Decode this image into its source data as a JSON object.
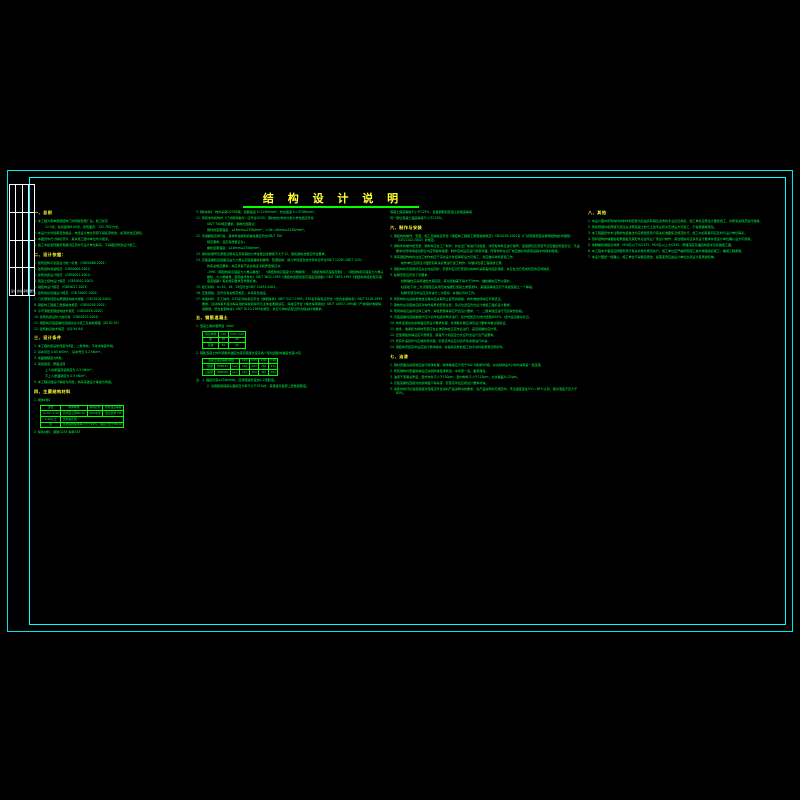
{
  "drawing": {
    "title": "结 构 设 计 说 明",
    "colors": {
      "background": "#000000",
      "border": "#00ffff",
      "heading": "#ffff33",
      "body": "#00ff44",
      "titleblock": "#ffffff"
    }
  },
  "title_block": {
    "rows": [
      [
        "",
        "",
        "",
        ""
      ],
      [
        "",
        "",
        "",
        ""
      ],
      [
        "",
        "",
        "",
        ""
      ],
      [
        "设计",
        "校对",
        "审核",
        "图号"
      ]
    ]
  },
  "col1": {
    "sections": [
      {
        "heading": "一、总则",
        "items": [
          "1. 本工程为某单层钢结构门式刚架轻钢厂房；檐口标高",
          "12.5米，柱间距离6.00米，建筑面积：152.78平方米。",
          "2. 本设计文件经审查合格后，未经设计单位同意不得任意修改，如有修改应通知。",
          "3. 本图纸中尺寸除标高外，其余施工图中单位均为毫米。",
          "4. 施工中如发现图纸有疑问应及时与设计单位联系，不得擅自修改设计施工。"
        ]
      },
      {
        "heading": "二、设计依据：",
        "items": [
          "1. 建筑结构可靠度设计统一标准            （GB50068-2001）",
          "2. 建筑结构荷载规范                      （GB50009-2001）",
          "3. 建筑抗震设计规范                      （GB50011-2001）",
          "4. 混凝土结构设计规范                    （GB50010-2002）",
          "5. 钢结构设计规范                        （GB50017-2003）",
          "6. 建筑地基基础设计规范                  （GB 50007-2002）",
          "7. 门式刚架轻型房屋钢结构技术规程        （CECS102:2002）",
          "8. 钢结构工程施工质量验收规范            （GB50205-2001）",
          "9. 冷弯薄壁型钢结构技术规范              （GB50018-2002）",
          "10. 建筑抗震设防分类标准                  （GB50223-2004）",
          "11. 钢结构高强度螺栓连接的设计施工及验收规程（JGJ 82-91）",
          "12. 建筑桩基技术规范                      （JGJ 94-94）"
        ]
      },
      {
        "heading": "三、设计条件",
        "items": [
          "1. 本工程抗震设防烈度为6度，二类场地，不考虑地震作用。",
          "2. 基本风压 0.65 kN/m²。    基本雪压 0.2 kN/m²。",
          "3. 地面粗糙度为B类。",
          "4. 荷载取值：屋面活荷",
          "  上人的屋面荷载取值为 0.5 kN/m²；",
          "  不上人屋面取值为 0.5 kN/m²。",
          "5. 本工程基础设计等级为丙级，地基基础设计等级为丙级。"
        ]
      },
      {
        "heading": "四、主要结构材料",
        "items": [
          "1. 砌体材料"
        ],
        "table": {
          "headers": [
            "部位",
            "砌体种类",
            "砌筑砂浆",
            "砂浆强度等级"
          ],
          "rows": [
            [
              "-0.20～1.20",
              "页岩实心砖MU10",
              "M10水泥",
              "混合砂浆 M5"
            ],
            [
              "1.20以上",
              "页岩多孔砖",
              "",
              ""
            ],
            [
              "注",
              "页岩砖的吸水率不大于25%，强度不低于MU10"
            ]
          ]
        },
        "items_after": [
          "2. 焊条材料：钢筋Q235 焊条E43"
        ]
      }
    ]
  },
  "col2": {
    "items": [
      "3. 钢材材料：构件采用Q235B钢，屈服强度 f=215N/mm²，抗拉强度 fᵤ=370N/mm²。",
      "11. 所有零件和构件（门式刚架板件）应符合Q345，钢材的化学成分和力学性能应符合",
      "GB/T 700规定要求，钢材的屈服点：",
      "  钢材的屈服强度：≤16mm≥235N/mm²，>16～40mm≥225N/mm²。",
      "12. 普通螺栓应用C级，其材料性能和机械性能应符合GB/T 700",
      "  规定要求，且应有质量证书；",
      "  螺栓屈服强度：≤16mm≥235N/mm²。",
      "13. 钢材的钢号及质量证明书应具有钢的力学性能且含碳量不大于12，硫和磷的含量应符合要求。",
      "14. 高强度螺栓连接副应由大六角头高强度螺栓和螺母、垫圈组成，其力学性能及技术条件应符合GB/T 1228～GB/T 1231",
      "  的有关规定要求，并应具有产品合格证书和质量保证书；",
      "  -1991《钢结构用高强度大六角头螺栓》、《钢结构用高强度大六角螺母》、《钢结构用高强度垫圈》、《钢结构用高强度大六角头螺栓、大六角螺母、垫圈技术条件》GB/T 3632-1995《钢结构用扭剪型高强度连接副》GB/T 3633-1995《钢结构用扭剪型高强度连接副》有关规定要求及质量标准。",
      "15. 栓钉材料：d=10、16、19应符合GB/T 10433-2002。",
      "16. 压型钢板：应符合有关规范规定，并具有合格证。",
      "17. 焊接材料：手工焊时，E43系列焊条应符合《碳钢焊条》GB/T 5117-1995；E50系列焊条应符合《低合金钢焊条》GB/T 5118-1995要求。自动焊和半自动焊采用的焊丝和焊剂与主体金属相适应，焊丝应符合《熔化焊用钢丝》GB/T 14957-1994和《气体保护电弧焊用碳钢、低合金钢焊丝》GB/T 8110-1995的规定，并应与母材匹配且符合相关标准要求。"
    ],
    "sections": [
      {
        "heading": "五、钢筋混凝土",
        "items": [
          "1. 混凝土保护层厚度（mm）"
        ],
        "table1": {
          "headers": [
            "环境\\构件",
            "C20",
            "C25～C45"
          ],
          "rows": [
            [
              "梁",
              "30",
              "25"
            ],
            [
              "基础",
              "40",
              "40"
            ]
          ]
        },
        "items_mid": [
          "2. 钢筋混凝土构件钢筋的锚固长度和搭接长度及各个受拉钢筋的锚固长度La见"
        ],
        "table2": {
          "headers": [
            "混凝土强度等级\\钢筋",
            "C20",
            "C25",
            "C30",
            "C40"
          ],
          "rows": [
            [
              "一级钢",
              "HPB235",
              "La=",
              "30d",
              "28d",
              "25d",
              "23d"
            ],
            [
              "二级钢",
              "HRB335",
              "La=",
              "44d",
              "35d",
              "31d",
              "29d"
            ]
          ]
        },
        "items_after": [
          "注：1. 锚固长度≥250mm时，应按搭接长度的1.2倍取值。",
          "  2. 当钢筋搭接接头面积百分率不大于25%时，其搭接长度按上表数值取值。"
        ]
      }
    ]
  },
  "col3": {
    "intro": [
      "混凝土强度等级不小于C25%，且各钢筋和混凝土的强度等级",
      "同一部位混凝土强度等级不小于C25%。"
    ],
    "sections": [
      {
        "heading": "六、制作与安装",
        "items": [
          "1. 钢结构的制作、安装、施工及验收应符合《钢结构工程施工质量验收规范》GB50205-2001及《门式刚架轻型房屋钢结构技术规程》（CECS102:2002）的规定。",
          "2. 钢构件的制作和安装：钢构件应在工厂制作，并在出厂前进行试组装，对所有构件应进行编号，连接部位及安装节点应做出明显标记，凡是要求在现场焊接的部位均应预留焊接量，制作完成后应进行防腐处理。所有构件在出厂前应做好防腐和运输中的保护措施。",
          "3. 所有钢结构构件在加工制作前应于深化设计并经审核后方可施工，并应做好材料复验工作；",
          "  制作单位应按设计图纸和有关标准进行加工制作，并做好隐蔽工程验收记录。",
          "4. 钢结构的安装顺序应先主体后围护，安装时应对已安装好的构件采取临时固定措施，并应在当日形成稳定的空间体系。",
          "5. 柱脚安装应符合下列要求：",
          "  柱脚锚栓应采用锚栓支架固定，其位置偏差不得大于5mm，锚栓螺纹应予以保护。",
          "  柱底板下的二次浇灌层应采用无收缩细石混凝土或灌浆料，其强度等级应高于基础混凝土一个等级。",
          "  柱脚安装完毕后应及时进行二次灌浆，并做好养护工作。",
          "6. 所有构件在运输和堆放过程中应采取防止变形的措施，构件堆放场地应平整坚实。",
          "7. 钢构件在吊装前应核对构件编号和安装位置，吊点位置应符合设计或施工组织设计要求。",
          "8. 现场焊接应由持证焊工操作，焊缝质量等级应符合设计要求，一、二级焊缝应进行无损探伤检验。",
          "9. 高强度螺栓连接副施拧应分初拧和终拧两步进行，初拧扭矩应为终拧扭矩的50%，终拧后应做好标记。",
          "10. 构件连接处的摩擦面应按设计要求处理，抗滑移系数应满足设计要求并做试验验证。",
          "11. 檩条、墙梁和支撑的安装应在主体结构校正完毕后进行，其连接螺栓应拧紧。",
          "12. 压型钢板的铺设应平整顺直，搭接尺寸和固定方式应符合设计及产品要求。",
          "13. 所有外露铁件均应做防腐处理，安装完毕后应对损坏的涂层进行补涂。",
          "14. 钢结构安装完毕后应进行整体验收，并提供完整的施工技术资料和质量证明文件。"
        ]
      },
      {
        "heading": "七、油漆",
        "items": [
          "1. 钢材表面在涂装前应进行除锈处理，除锈等级应不低于Sa2.5级或St3级，并在除锈后4小时内涂装第一道底漆。",
          "2. 所有钢构件表面除锈后应涂刷防锈底漆两道，中间漆一道，面漆两道。",
          "3. 油漆干漆膜总厚度：室外构件不小于150μm，室内构件不小于125μm，允许偏差为-25μm。",
          "4. 高强度螺栓连接处的摩擦面不得涂漆，安装完毕后应按设计要求补涂。",
          "5. 涂装时的环境温度和相对湿度应符合涂料产品说明书的要求，当产品说明书无规定时，环境温度宜在5℃～38℃之间，相对湿度不应大于85%。"
        ]
      }
    ]
  },
  "col4": {
    "sections": [
      {
        "heading": "八、其他",
        "items": [
          "1. 本设计图中所有构件的制作和安装均应由具有相应资质的专业队伍承担，施工单位应按设计图纸施工，并按有关规范进行验收。",
          "2. 所有预埋件和预留孔洞应在浇筑混凝土前与土建专业核对无误后方可施工，不得遗漏或错位。",
          "3. 本工程图纸中未注明的构造做法均应按国家现行有关标准图集及规范执行，施工中如有疑问应及时与设计单位联系。",
          "4. 围护结构的墙面板和屋面板及其配件应由专业厂家设计制作，其性能指标应满足设计要求并经设计单位确认后方可使用。",
          "5. 地脚螺栓规格及材质：M16及以下为Q235，M20及以上为Q345，预埋深度及锚固构造详见基础施工图。",
          "6. 本工程未尽事宜应按国家现行有关标准及规范执行，施工单位应严格按照施工技术规程组织施工，确保工程质量。",
          "7. 本设计图纸一经确认，施工单位不得擅自更改，如需变更应由设计单位出具设计变更通知单。"
        ]
      }
    ]
  }
}
